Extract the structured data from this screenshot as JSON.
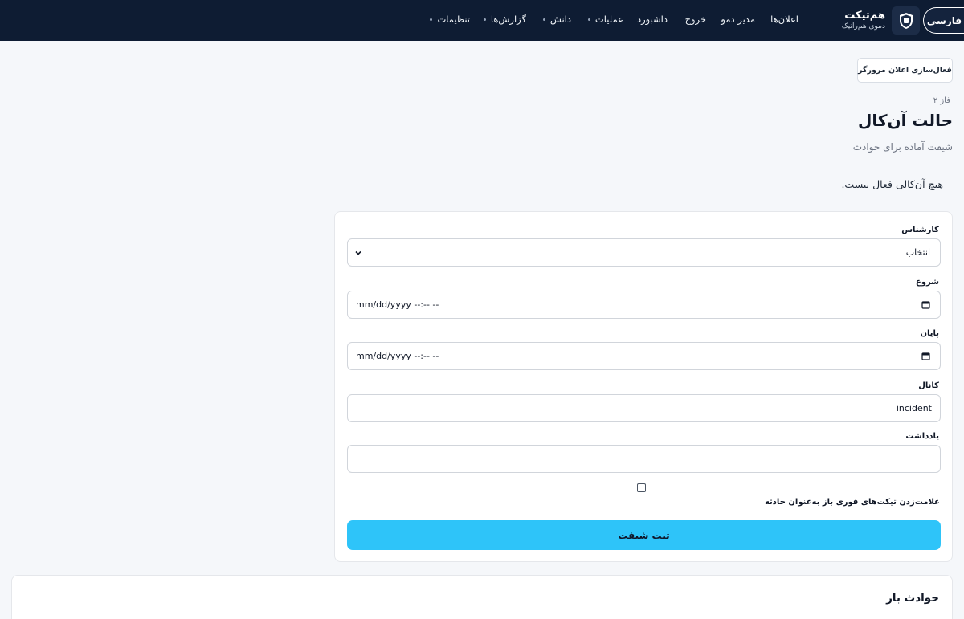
{
  "header": {
    "language": "فارسی",
    "brand_title": "هم‌تیکت",
    "brand_subtitle": "دموی هم‌راتیک",
    "nav": [
      {
        "label": "اعلان‌ها",
        "dropdown": false
      },
      {
        "label": "مدیر دمو",
        "dropdown": false
      },
      {
        "label": "خروج",
        "dropdown": false
      },
      {
        "label": "داشبورد",
        "dropdown": false
      },
      {
        "label": "عملیات",
        "dropdown": true
      },
      {
        "label": "دانش",
        "dropdown": true
      },
      {
        "label": "گزارش‌ها",
        "dropdown": true
      },
      {
        "label": "تنظیمات",
        "dropdown": true
      }
    ]
  },
  "page": {
    "activate_button": "فعال‌سازی اعلان مرورگر",
    "phase": "فاز ۲",
    "title": "حالت آن‌کال",
    "subtitle": "شیفت آماده برای حوادث",
    "empty_message": "هیچ آن‌کالی فعال نیست."
  },
  "form": {
    "expert_label": "کارشناس",
    "expert_value": "انتخاب",
    "start_label": "شروع",
    "start_value": "mm/dd/yyyy --:-- --",
    "end_label": "پایان",
    "end_value": "mm/dd/yyyy --:-- --",
    "channel_label": "کانال",
    "channel_value": "incident",
    "note_label": "یادداشت",
    "note_value": "",
    "checkbox_label": "علامت‌زدن تیکت‌های فوری باز به‌عنوان حادثه",
    "submit_label": "ثبت شیفت"
  },
  "incidents": {
    "title": "حوادث باز"
  }
}
